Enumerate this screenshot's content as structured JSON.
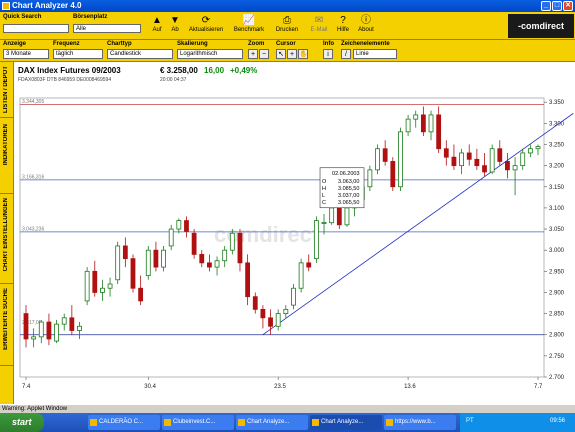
{
  "window": {
    "title": "Chart Analyzer 4.0",
    "buttons": [
      "_",
      "□",
      "✕"
    ]
  },
  "toolbar": {
    "quick_search_label": "Quick Search",
    "quick_search_value": "",
    "exchange_label": "Börsenplatz",
    "exchange_value": "Alle",
    "buttons": [
      {
        "label": "Auf",
        "icon": "arrow-up-icon"
      },
      {
        "label": "Ab",
        "icon": "arrow-down-icon"
      },
      {
        "label": "Aktualisieren",
        "icon": "refresh-icon"
      },
      {
        "label": "Benchmark",
        "icon": "benchmark-icon"
      },
      {
        "label": "Drucken",
        "icon": "printer-icon"
      },
      {
        "label": "E-Mail",
        "icon": "email-icon"
      },
      {
        "label": "Hilfe",
        "icon": "help-icon"
      },
      {
        "label": "About",
        "icon": "info-icon"
      }
    ],
    "brand": "-comdirect"
  },
  "settings": {
    "anzeige": {
      "label": "Anzeige",
      "value": "3 Monate"
    },
    "frequenz": {
      "label": "Frequenz",
      "value": "täglich"
    },
    "charttyp": {
      "label": "Charttyp",
      "value": "Candlestick"
    },
    "skalierung": {
      "label": "Skalierung",
      "value": "Logarithmisch"
    },
    "zoom": {
      "label": "Zoom"
    },
    "cursor": {
      "label": "Cursor"
    },
    "info": {
      "label": "Info"
    },
    "zeichen": {
      "label": "Zeichenelemente",
      "value": "Linie"
    }
  },
  "sidebar": [
    "LISTEN / DEPOT",
    "INDIKATOREN",
    "CHART EINSTELLUNGEN",
    "ERWEITERTE SUCHE"
  ],
  "instrument": {
    "name": "DAX Index Futures 09/2003",
    "price": "€ 3.258,00",
    "change": "16,00",
    "change_pct": "+0,49%",
    "sub": "FDAX0803F DTB    846959    DE0008469594",
    "time": "20:00   04:37"
  },
  "chart_data": {
    "type": "candlestick",
    "y_ticks": [
      "3.350",
      "3.300",
      "3.250",
      "3.200",
      "3.150",
      "3.100",
      "3.050",
      "3.000",
      "2.950",
      "2.900",
      "2.850",
      "2.800",
      "2.750",
      "2.700"
    ],
    "ylim": [
      2700,
      3360
    ],
    "x_ticks": [
      "7.4",
      "30.4",
      "23.5",
      "13.6",
      "7.7"
    ],
    "x_tick_index": [
      0,
      16,
      33,
      50,
      67
    ],
    "h_lines": [
      {
        "label": "3.344,305",
        "value": 3344.305,
        "color": "#c04040"
      },
      {
        "label": "3.166,316",
        "value": 3166.316,
        "color": "#4060d0"
      },
      {
        "label": "3.043,236",
        "value": 3043.236,
        "color": "#4060d0"
      },
      {
        "label": "",
        "value": 2800,
        "color": "#2030a0"
      }
    ],
    "left_ref_label": "2.817,05",
    "trendline": [
      [
        31,
        2800
      ],
      [
        69,
        3300
      ]
    ],
    "tooltip": {
      "date": "02.06.2003",
      "rows": [
        {
          "k": "O",
          "v": "3.063,00"
        },
        {
          "k": "H",
          "v": "3.085,50"
        },
        {
          "k": "L",
          "v": "3.037,00"
        },
        {
          "k": "C",
          "v": "3.065,50"
        }
      ],
      "index": 39
    },
    "watermark": "comdirect",
    "candles": [
      [
        2850,
        2870,
        2770,
        2790
      ],
      [
        2790,
        2815,
        2770,
        2795
      ],
      [
        2795,
        2835,
        2780,
        2830
      ],
      [
        2830,
        2850,
        2775,
        2790
      ],
      [
        2785,
        2835,
        2780,
        2825
      ],
      [
        2825,
        2850,
        2810,
        2840
      ],
      [
        2840,
        2870,
        2800,
        2810
      ],
      [
        2810,
        2830,
        2790,
        2820
      ],
      [
        2880,
        2960,
        2870,
        2950
      ],
      [
        2950,
        2975,
        2890,
        2900
      ],
      [
        2900,
        2930,
        2880,
        2910
      ],
      [
        2910,
        2935,
        2890,
        2920
      ],
      [
        2930,
        3020,
        2920,
        3010
      ],
      [
        3010,
        3030,
        2960,
        2980
      ],
      [
        2980,
        2990,
        2900,
        2910
      ],
      [
        2910,
        2940,
        2870,
        2880
      ],
      [
        2940,
        3010,
        2930,
        3000
      ],
      [
        3000,
        3020,
        2950,
        2960
      ],
      [
        2960,
        3010,
        2950,
        3000
      ],
      [
        3010,
        3060,
        3000,
        3050
      ],
      [
        3050,
        3075,
        3040,
        3070
      ],
      [
        3070,
        3080,
        3030,
        3045
      ],
      [
        3040,
        3050,
        2980,
        2990
      ],
      [
        2990,
        3000,
        2960,
        2970
      ],
      [
        2970,
        2990,
        2950,
        2960
      ],
      [
        2960,
        2985,
        2940,
        2975
      ],
      [
        2975,
        3010,
        2960,
        3000
      ],
      [
        3000,
        3050,
        2990,
        3040
      ],
      [
        3040,
        3050,
        2950,
        2970
      ],
      [
        2970,
        2990,
        2870,
        2890
      ],
      [
        2890,
        2900,
        2850,
        2860
      ],
      [
        2860,
        2870,
        2815,
        2840
      ],
      [
        2840,
        2860,
        2800,
        2820
      ],
      [
        2820,
        2860,
        2810,
        2850
      ],
      [
        2850,
        2870,
        2840,
        2860
      ],
      [
        2870,
        2920,
        2860,
        2910
      ],
      [
        2910,
        2980,
        2900,
        2970
      ],
      [
        2970,
        2990,
        2950,
        2960
      ],
      [
        2980,
        3080,
        2970,
        3070
      ],
      [
        3063,
        3085.5,
        3037,
        3065.5
      ],
      [
        3065,
        3110,
        3060,
        3100
      ],
      [
        3100,
        3120,
        3050,
        3060
      ],
      [
        3060,
        3110,
        3055,
        3100
      ],
      [
        3100,
        3130,
        3080,
        3120
      ],
      [
        3120,
        3160,
        3110,
        3150
      ],
      [
        3150,
        3200,
        3140,
        3190
      ],
      [
        3190,
        3250,
        3180,
        3240
      ],
      [
        3240,
        3260,
        3200,
        3210
      ],
      [
        3210,
        3220,
        3140,
        3150
      ],
      [
        3150,
        3290,
        3140,
        3280
      ],
      [
        3280,
        3320,
        3270,
        3310
      ],
      [
        3310,
        3330,
        3290,
        3320
      ],
      [
        3320,
        3340,
        3270,
        3280
      ],
      [
        3280,
        3330,
        3260,
        3320
      ],
      [
        3320,
        3340,
        3230,
        3240
      ],
      [
        3240,
        3260,
        3200,
        3220
      ],
      [
        3220,
        3250,
        3190,
        3200
      ],
      [
        3200,
        3240,
        3180,
        3230
      ],
      [
        3230,
        3250,
        3200,
        3215
      ],
      [
        3215,
        3240,
        3190,
        3200
      ],
      [
        3200,
        3230,
        3175,
        3185
      ],
      [
        3185,
        3250,
        3180,
        3240
      ],
      [
        3240,
        3260,
        3200,
        3210
      ],
      [
        3210,
        3230,
        3170,
        3190
      ],
      [
        3190,
        3220,
        3130,
        3200
      ],
      [
        3200,
        3240,
        3190,
        3230
      ],
      [
        3230,
        3250,
        3220,
        3240
      ],
      [
        3240,
        3250,
        3225,
        3245
      ]
    ],
    "colors": {
      "up": "#1a7a1a",
      "down": "#b01010"
    }
  },
  "status": "Warning: Applet Window",
  "taskbar": {
    "start": "start",
    "tasks": [
      "CALDERÃO C...",
      "Clubeinvest.C...",
      "Chart Analyze...",
      "Chart Analyze...",
      "https://www.b..."
    ],
    "tray_lang": "PT",
    "clock": "09:56"
  }
}
